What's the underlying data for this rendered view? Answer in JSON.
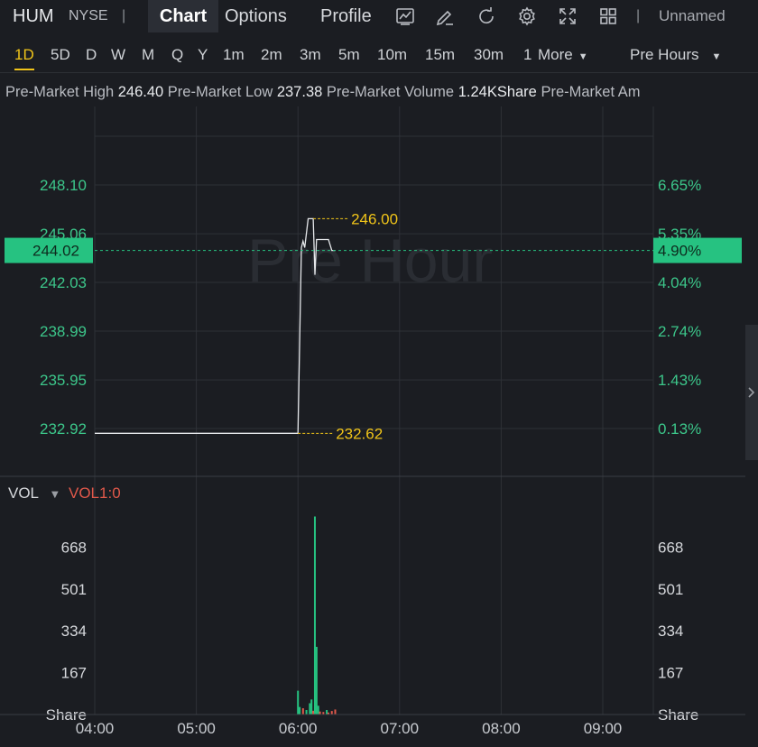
{
  "header": {
    "ticker": "HUM",
    "exchange": "NYSE",
    "tabs": [
      "Chart",
      "Options",
      "Profile"
    ],
    "active_tab": "Chart",
    "icons": [
      "indicator-chart-icon",
      "draw-pencil-icon",
      "refresh-icon",
      "settings-gear-icon",
      "fullscreen-icon",
      "layout-grid-icon"
    ],
    "layout_name": "Unnamed"
  },
  "timeframes": [
    "1D",
    "5D",
    "D",
    "W",
    "M",
    "Q",
    "Y",
    "1m",
    "2m",
    "3m",
    "5m",
    "10m",
    "15m",
    "30m",
    "1"
  ],
  "active_timeframe": "1D",
  "more_label": "More",
  "session_select": "Pre Hours",
  "stats": [
    {
      "label": "Pre-Market High",
      "value": "246.40"
    },
    {
      "label": "Pre-Market Low",
      "value": "237.38"
    },
    {
      "label": "Pre-Market Volume",
      "value": "1.24KShare"
    },
    {
      "label": "Pre-Market Am",
      "value": ""
    }
  ],
  "watermark": "Pre Hour",
  "colors": {
    "background": "#1b1d22",
    "grid": "#2e3137",
    "axis_text": "#3cc68a",
    "price_tag": "#26c281",
    "annotation": "#f0c419",
    "price_line": "#e6e8eb",
    "vol_up": "#26c281",
    "vol_down": "#e0584a",
    "vol1_label": "#e0584a"
  },
  "chart_data": [
    {
      "type": "line",
      "name": "price",
      "x_ticks": [
        "04:00",
        "05:00",
        "06:00",
        "07:00",
        "08:00",
        "09:00"
      ],
      "y_ticks": [
        "248.10",
        "245.06",
        "242.03",
        "238.99",
        "235.95",
        "232.92"
      ],
      "y_ticks_right": [
        "6.65%",
        "5.35%",
        "4.04%",
        "2.74%",
        "1.43%",
        "0.13%"
      ],
      "ylim": [
        229.88,
        251.14
      ],
      "current_price": "244.02",
      "current_change": "4.90%",
      "annotations": [
        {
          "label": "246.00",
          "value": 246.0
        },
        {
          "label": "232.62",
          "value": 232.62
        }
      ],
      "x": [
        "04:00",
        "06:00",
        "06:00",
        "06:02",
        "06:03",
        "06:04",
        "06:06",
        "06:08",
        "06:09",
        "06:10",
        "06:11",
        "06:12",
        "06:14",
        "06:16",
        "06:18",
        "06:20",
        "06:22"
      ],
      "y": [
        232.62,
        232.62,
        232.62,
        244.2,
        244.6,
        244.2,
        246.0,
        246.0,
        246.0,
        242.5,
        244.7,
        244.7,
        244.7,
        244.7,
        244.7,
        244.02,
        244.02
      ]
    },
    {
      "type": "bar",
      "name": "VOL",
      "label": "VOL",
      "sub_label": "VOL1:0",
      "unit": "Share",
      "y_ticks": [
        "668",
        "501",
        "334",
        "167"
      ],
      "ylim": [
        0,
        835
      ],
      "x": [
        "06:00",
        "06:01",
        "06:03",
        "06:05",
        "06:07",
        "06:08",
        "06:09",
        "06:10",
        "06:11",
        "06:12",
        "06:13",
        "06:15",
        "06:17",
        "06:18",
        "06:20",
        "06:22"
      ],
      "values": [
        95,
        30,
        25,
        18,
        45,
        60,
        15,
        790,
        270,
        35,
        12,
        10,
        18,
        8,
        14,
        20
      ],
      "direction": [
        "up",
        "up",
        "down",
        "up",
        "up",
        "up",
        "down",
        "up",
        "up",
        "up",
        "down",
        "down",
        "up",
        "down",
        "down",
        "down"
      ]
    }
  ]
}
